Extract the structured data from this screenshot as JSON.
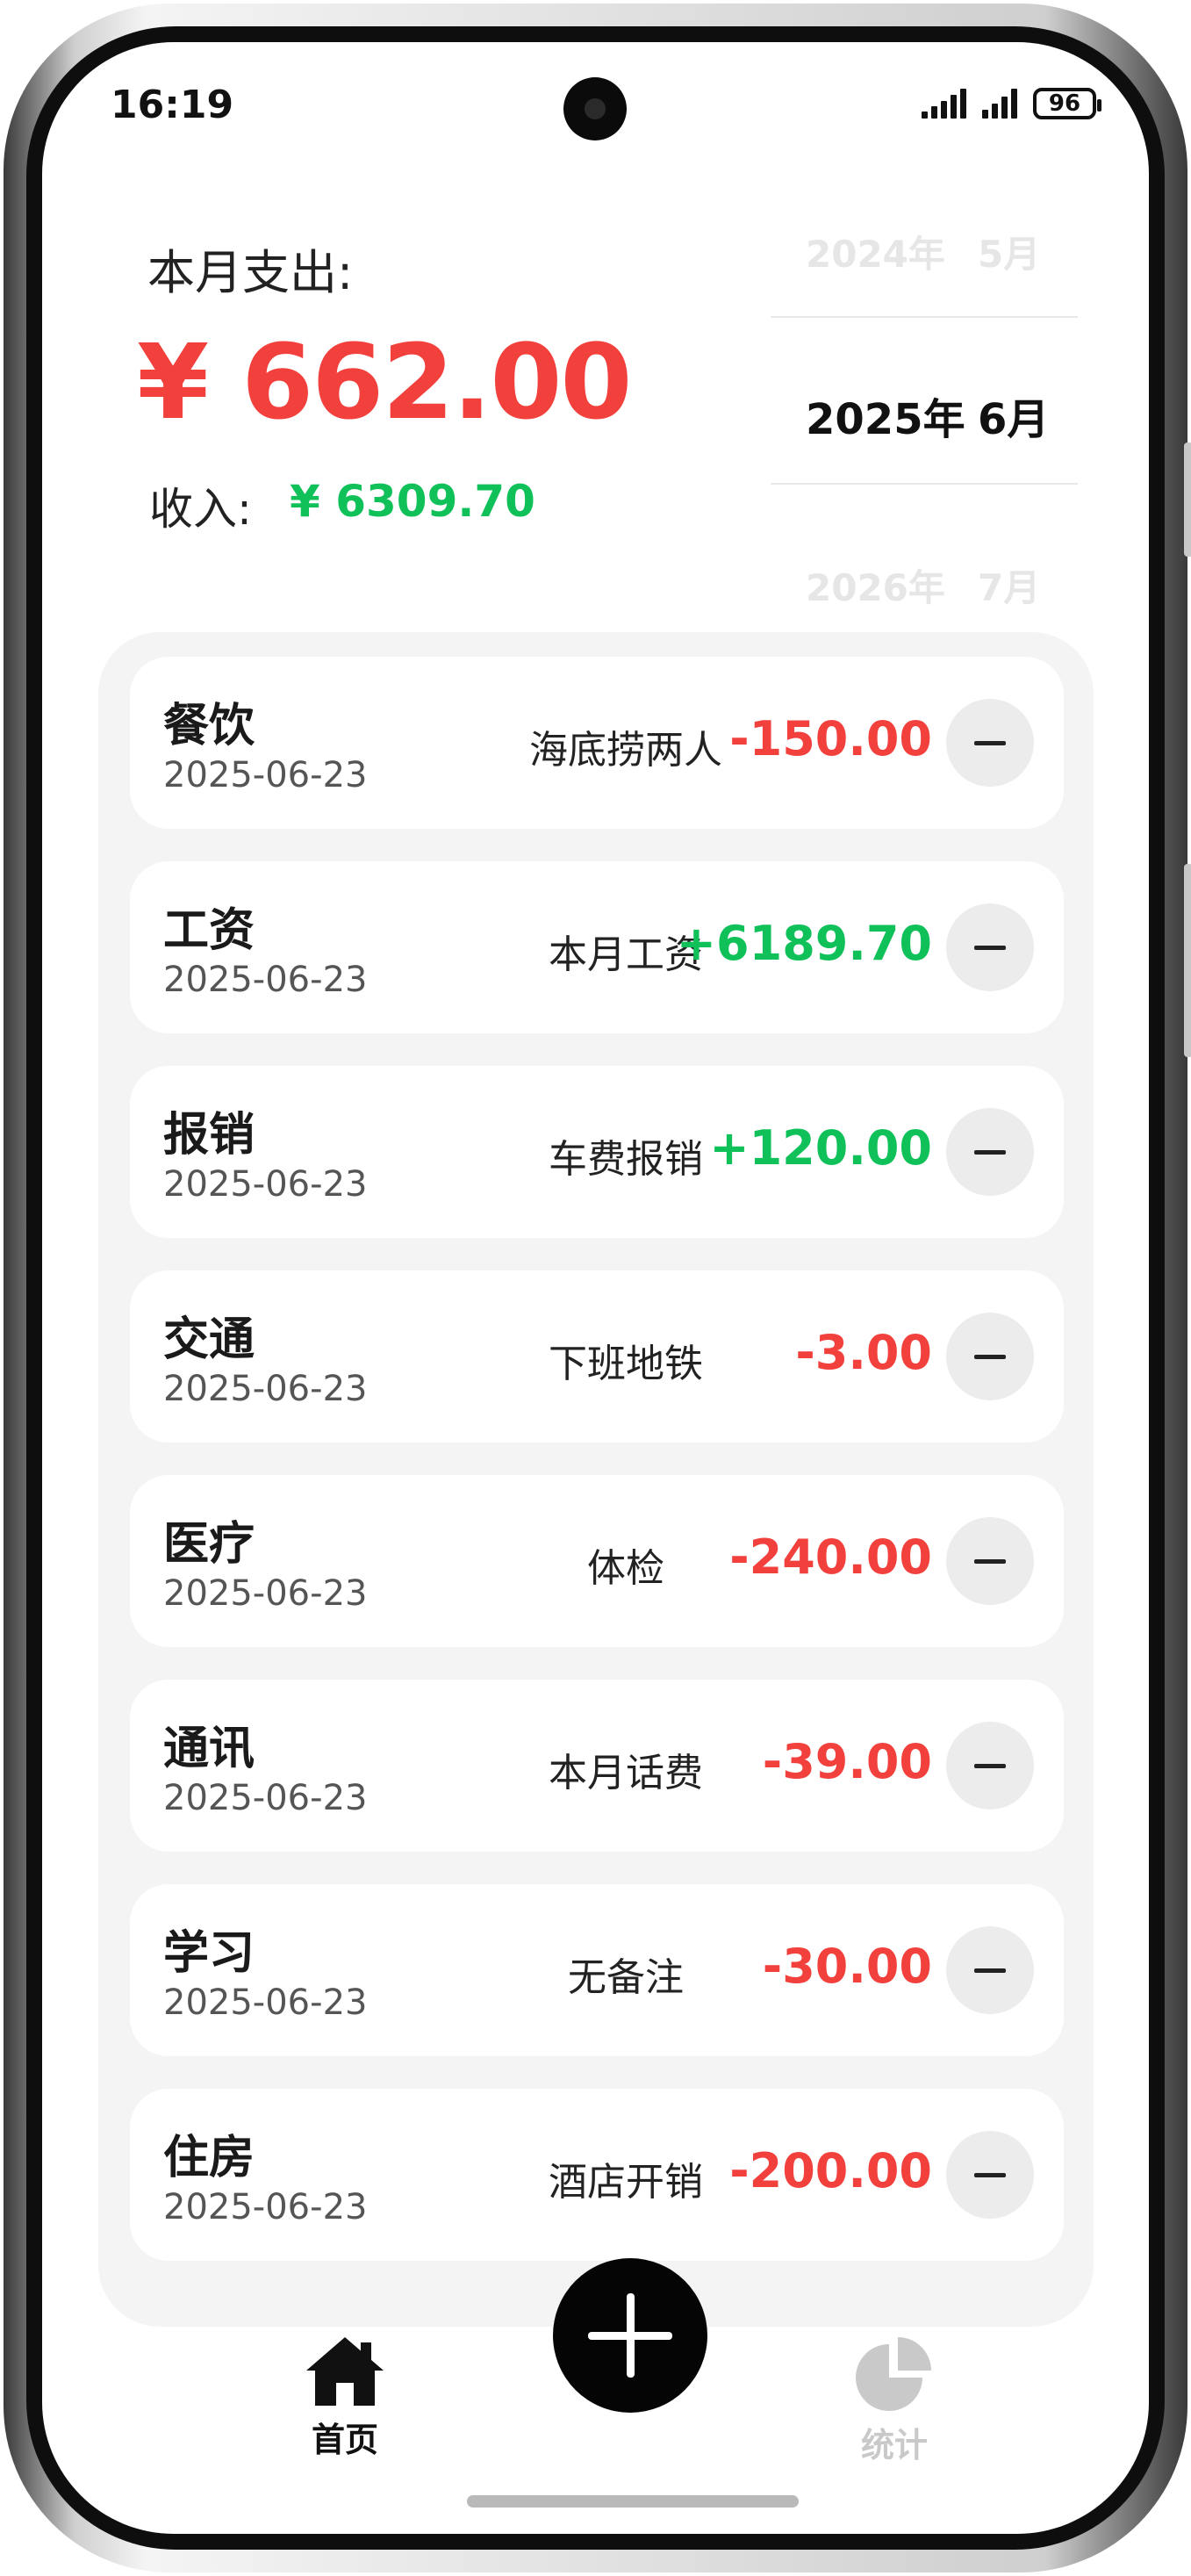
{
  "status_bar": {
    "time": "16:19",
    "battery": "96"
  },
  "summary": {
    "expense_label": "本月支出:",
    "expense_amount": "¥ 662.00",
    "income_label": "收入:",
    "income_amount": "¥ 6309.70"
  },
  "picker": {
    "prev": {
      "year": "2024年",
      "month": "5月"
    },
    "current": {
      "year": "2025年",
      "month": "6月"
    },
    "next": {
      "year": "2026年",
      "month": "7月"
    }
  },
  "records": [
    {
      "category": "餐饮",
      "date": "2025-06-23",
      "note": "海底捞两人",
      "amount": "-150.00",
      "type": "expense"
    },
    {
      "category": "工资",
      "date": "2025-06-23",
      "note": "本月工资",
      "amount": "+6189.70",
      "type": "income"
    },
    {
      "category": "报销",
      "date": "2025-06-23",
      "note": "车费报销",
      "amount": "+120.00",
      "type": "income"
    },
    {
      "category": "交通",
      "date": "2025-06-23",
      "note": "下班地铁",
      "amount": "-3.00",
      "type": "expense"
    },
    {
      "category": "医疗",
      "date": "2025-06-23",
      "note": "体检",
      "amount": "-240.00",
      "type": "expense"
    },
    {
      "category": "通讯",
      "date": "2025-06-23",
      "note": "本月话费",
      "amount": "-39.00",
      "type": "expense"
    },
    {
      "category": "学习",
      "date": "2025-06-23",
      "note": "无备注",
      "amount": "-30.00",
      "type": "expense"
    },
    {
      "category": "住房",
      "date": "2025-06-23",
      "note": "酒店开销",
      "amount": "-200.00",
      "type": "expense"
    }
  ],
  "nav": {
    "home_label": "首页",
    "stats_label": "统计",
    "home_icon": "house-icon",
    "stats_icon": "pie-chart-icon",
    "add_icon": "plus-icon"
  },
  "colors": {
    "expense": "#f2403d",
    "income": "#10c15a",
    "nav_active": "#111111",
    "nav_inactive": "#c9c9c9"
  }
}
